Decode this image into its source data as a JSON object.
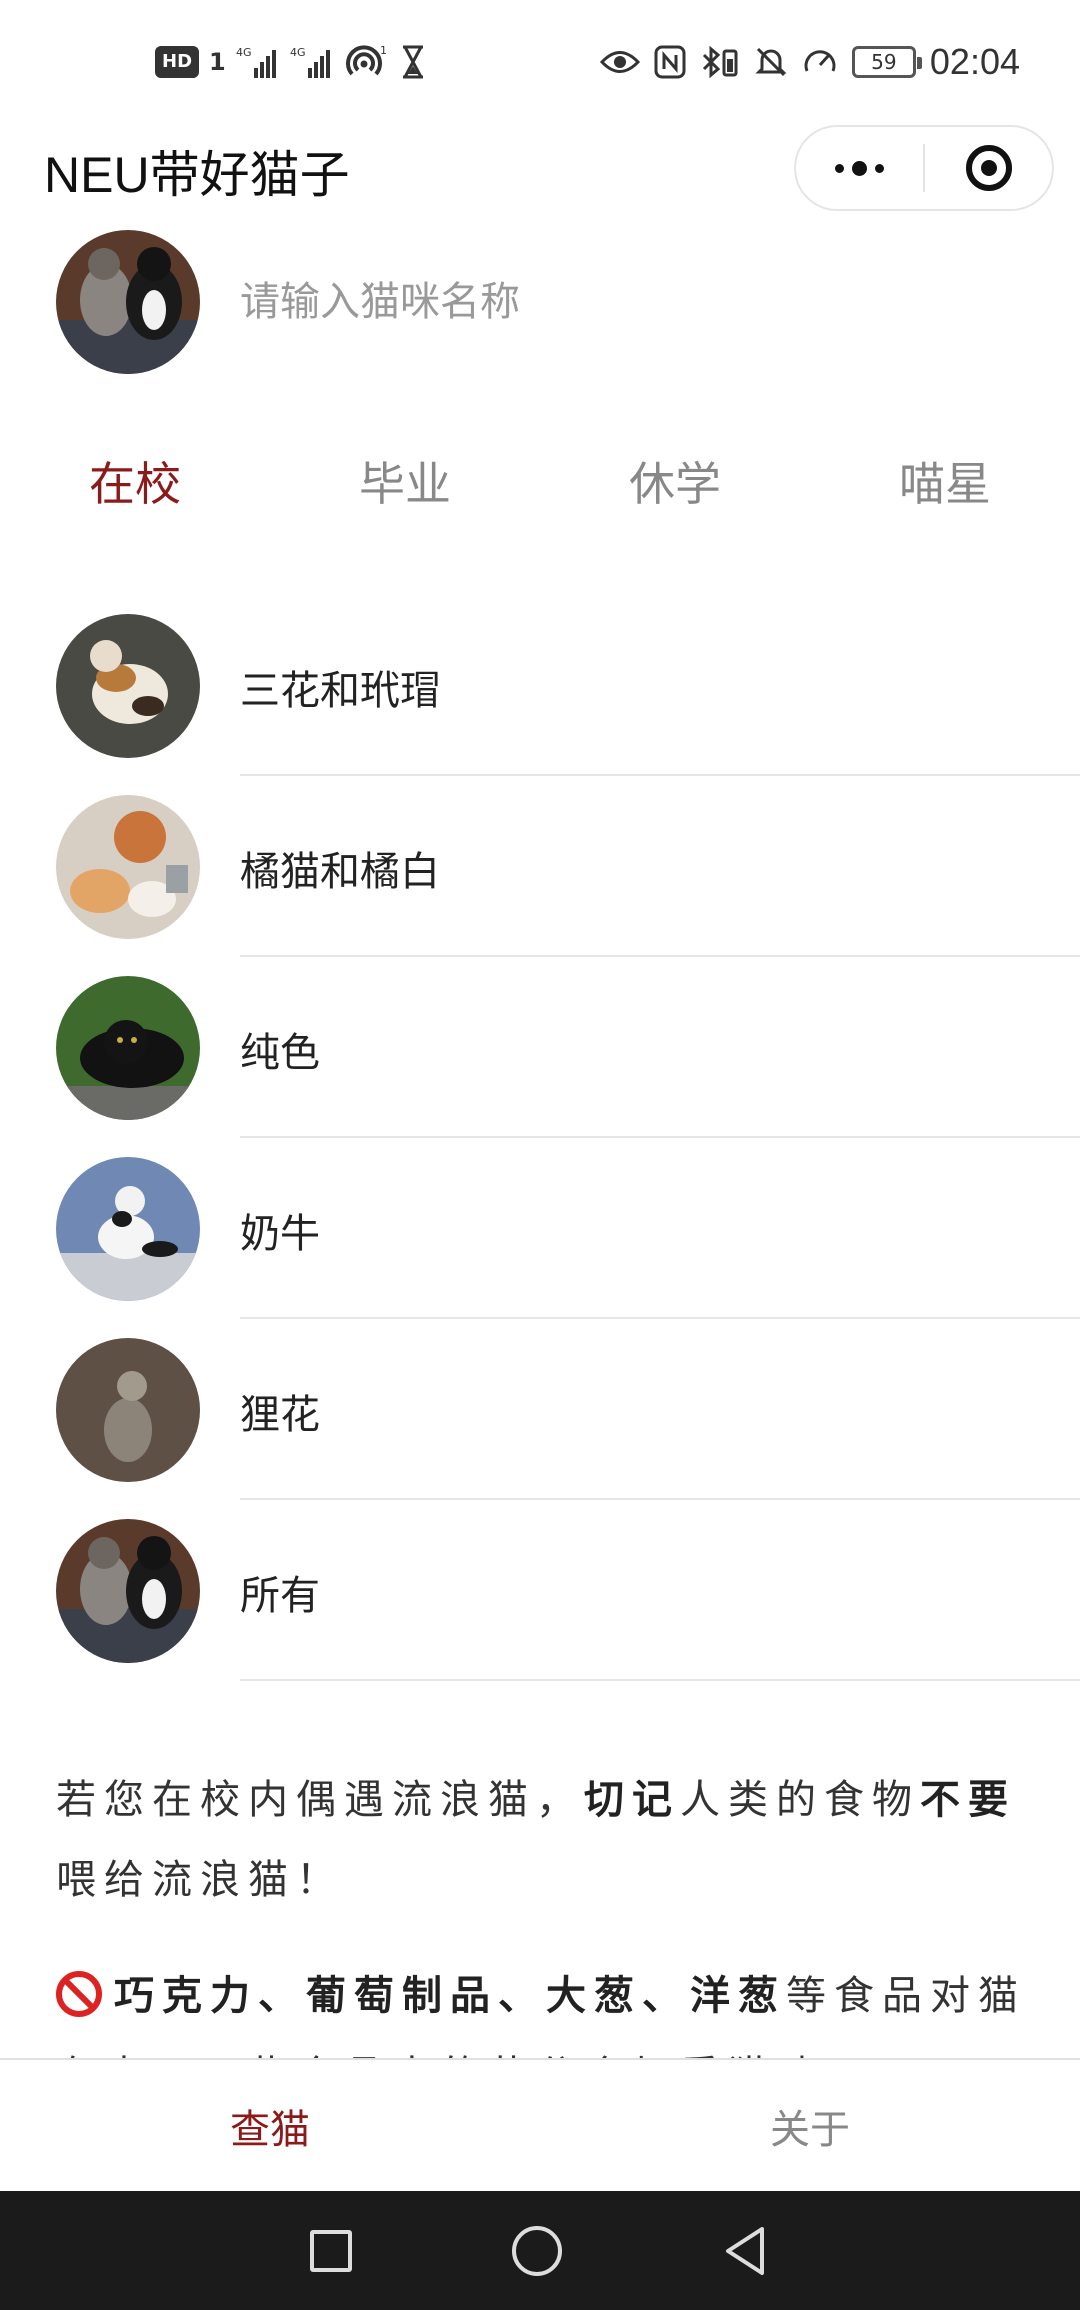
{
  "status_bar": {
    "left_icons": [
      "hd-icon",
      "sim-1-icon",
      "signal-4g-icon",
      "signal-4g-icon",
      "hotspot-icon",
      "hourglass-icon"
    ],
    "hd_label": "HD",
    "sim_label": "1",
    "net_label_1": "4G",
    "net_label_2": "4G",
    "hotspot_label": "1",
    "right_icons": [
      "eye-icon",
      "nfc-icon",
      "bluetooth-battery-icon",
      "mute-icon",
      "speed-icon"
    ],
    "battery": "59",
    "time": "02:04"
  },
  "title_bar": {
    "title": "NEU带好猫子",
    "more_icon": "more-dots-icon",
    "close_icon": "target-icon"
  },
  "search": {
    "placeholder": "请输入猫咪名称",
    "value": ""
  },
  "tabs": [
    {
      "label": "在校",
      "active": true
    },
    {
      "label": "毕业",
      "active": false
    },
    {
      "label": "休学",
      "active": false
    },
    {
      "label": "喵星",
      "active": false
    }
  ],
  "cats": [
    {
      "name": "三花和玳瑁"
    },
    {
      "name": "橘猫和橘白"
    },
    {
      "name": "纯色"
    },
    {
      "name": "奶牛"
    },
    {
      "name": "狸花"
    },
    {
      "name": "所有"
    }
  ],
  "info": {
    "p1_a": "若您在校内偶遇流浪猫，",
    "p1_b": "切记",
    "p1_c": "人类的食物",
    "p1_d": "不要",
    "p1_e": "喂给流浪猫！",
    "p2_a": "巧克力、葡萄制品、大葱、洋葱",
    "p2_b": "等食品对",
    "p2_c": "猫有毒，一些食品中的盐分会加重猫咪"
  },
  "tabbar": [
    {
      "label": "查猫",
      "active": true
    },
    {
      "label": "关于",
      "active": false
    }
  ],
  "colors": {
    "accent": "#8b1a1a",
    "inactive": "#888888",
    "divider": "#e6e6e6",
    "navbar": "#1b1b1b"
  }
}
